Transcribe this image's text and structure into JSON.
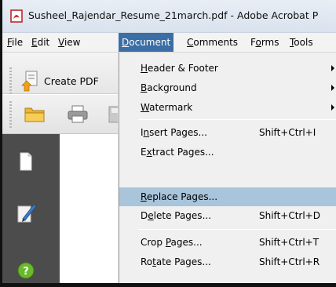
{
  "window": {
    "title": "Susheel_Rajendar_Resume_21march.pdf - Adobe Acrobat P",
    "app_icon": "acrobat-pdf-icon"
  },
  "menubar": {
    "items": [
      {
        "key": "F",
        "rest": "ile"
      },
      {
        "key": "E",
        "rest": "dit"
      },
      {
        "key": "V",
        "rest": "iew"
      },
      {
        "key": "D",
        "rest": "ocument"
      },
      {
        "key": "C",
        "rest": "omments"
      },
      {
        "pre": "F",
        "key": "o",
        "rest": "rms"
      },
      {
        "key": "T",
        "rest": "ools"
      }
    ],
    "active_index": 3
  },
  "toolbar": {
    "create_pdf_label": "Create PDF",
    "icons": [
      "create-pdf-icon",
      "open-folder-icon",
      "print-icon",
      "save-icon"
    ]
  },
  "navpane": {
    "icons": [
      "pages-icon",
      "signature-pen-icon",
      "help-icon"
    ]
  },
  "document_menu": {
    "items": [
      {
        "pre": "",
        "key": "H",
        "rest": "eader & Footer",
        "shortcut": "",
        "submenu": true
      },
      {
        "pre": "",
        "key": "B",
        "rest": "ackground",
        "shortcut": "",
        "submenu": true
      },
      {
        "pre": "",
        "key": "W",
        "rest": "atermark",
        "shortcut": "",
        "submenu": true
      },
      {
        "pre": "I",
        "key": "n",
        "rest": "sert Pages...",
        "shortcut": "Shift+Ctrl+I",
        "submenu": false
      },
      {
        "pre": "E",
        "key": "x",
        "rest": "tract Pages...",
        "shortcut": "",
        "submenu": false
      },
      {
        "pre": "",
        "key": "R",
        "rest": "eplace Pages...",
        "shortcut": "",
        "submenu": false,
        "highlighted": true
      },
      {
        "pre": "D",
        "key": "e",
        "rest": "lete Pages...",
        "shortcut": "Shift+Ctrl+D",
        "submenu": false
      },
      {
        "pre": "Crop ",
        "key": "P",
        "rest": "ages...",
        "shortcut": "Shift+Ctrl+T",
        "submenu": false
      },
      {
        "pre": "Ro",
        "key": "t",
        "rest": "ate Pages...",
        "shortcut": "Shift+Ctrl+R",
        "submenu": false
      }
    ]
  },
  "colors": {
    "menu_active": "#3a6ea5",
    "item_highlight": "#a8c5db",
    "nav_pane": "#4c4c4c"
  }
}
